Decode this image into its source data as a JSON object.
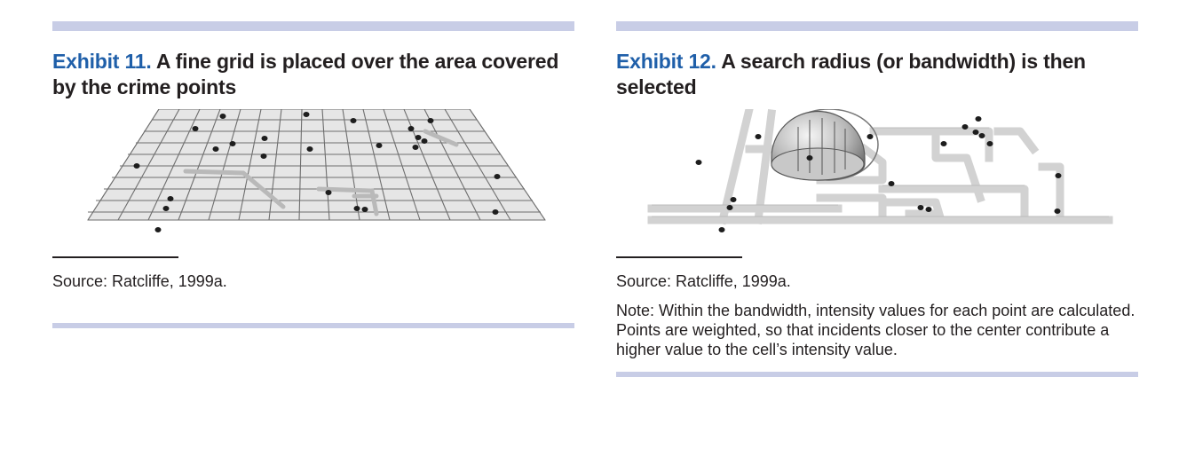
{
  "exhibit11": {
    "number": "Exhibit 11.",
    "title": "A fine grid is placed over the area covered by the crime points",
    "source": "Source: Ratcliffe, 1999a."
  },
  "exhibit12": {
    "number": "Exhibit 12.",
    "title": "A search radius (or bandwidth) is then selected",
    "source": "Source: Ratcliffe, 1999a.",
    "note": "Note: Within the bandwidth, intensity values for each point are calculated. Points are weighted, so that incidents closer to the center contribute a higher value to the cell’s intensity value."
  },
  "colors": {
    "exhibit_number": "#1f5fa9",
    "rule": "#c8cde6",
    "text": "#231f20"
  }
}
